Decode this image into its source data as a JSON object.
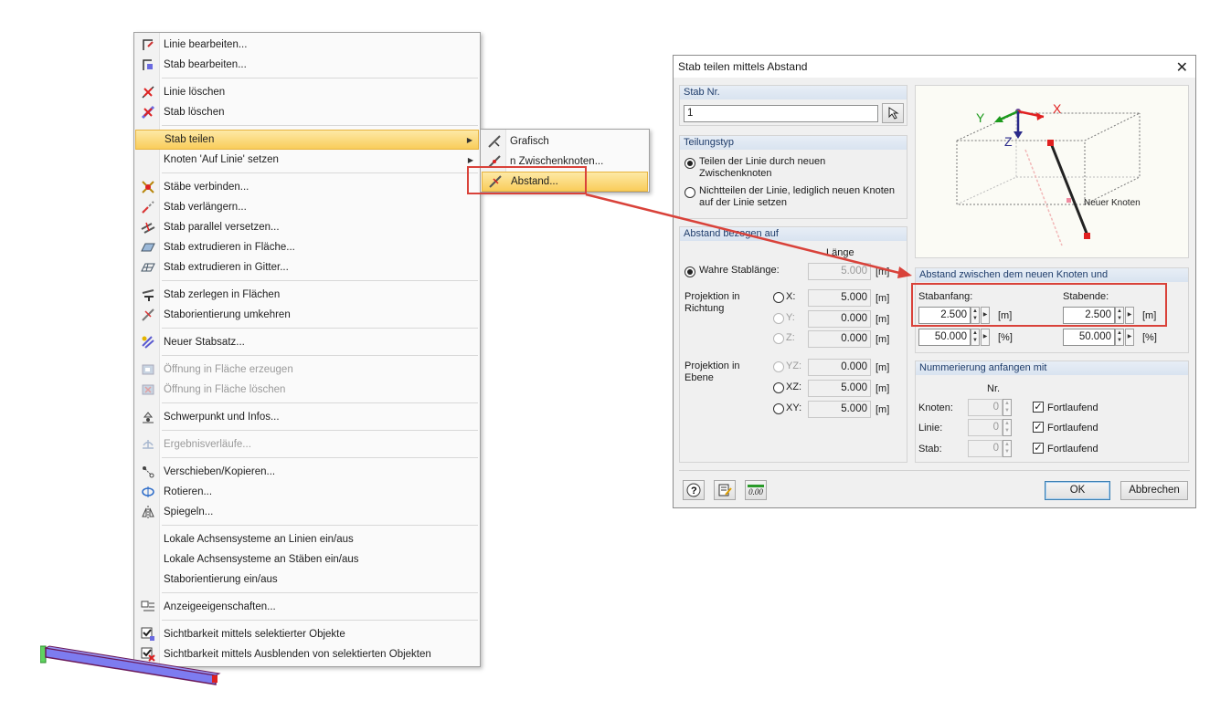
{
  "context_menu": {
    "items": [
      {
        "label": "Linie bearbeiten...",
        "icon": "edit-line-icon",
        "enabled": true
      },
      {
        "label": "Stab bearbeiten...",
        "icon": "edit-member-icon",
        "enabled": true
      },
      {
        "label": "Linie löschen",
        "icon": "delete-line-icon",
        "enabled": true
      },
      {
        "label": "Stab löschen",
        "icon": "delete-member-icon",
        "enabled": true
      },
      {
        "label": "Stab teilen",
        "icon": "",
        "enabled": true,
        "selected": true,
        "submenu": true
      },
      {
        "label": "Knoten 'Auf Linie' setzen",
        "icon": "",
        "enabled": true,
        "submenu": true
      },
      {
        "label": "Stäbe verbinden...",
        "icon": "connect-members-icon",
        "enabled": true
      },
      {
        "label": "Stab verlängern...",
        "icon": "extend-member-icon",
        "enabled": true
      },
      {
        "label": "Stab parallel versetzen...",
        "icon": "offset-member-icon",
        "enabled": true
      },
      {
        "label": "Stab extrudieren in Fläche...",
        "icon": "extrude-surface-icon",
        "enabled": true
      },
      {
        "label": "Stab extrudieren in Gitter...",
        "icon": "extrude-lattice-icon",
        "enabled": true
      },
      {
        "label": "Stab zerlegen in Flächen",
        "icon": "decompose-member-icon",
        "enabled": true
      },
      {
        "label": "Staborientierung umkehren",
        "icon": "reverse-orientation-icon",
        "enabled": true
      },
      {
        "label": "Neuer Stabsatz...",
        "icon": "new-set-icon",
        "enabled": true
      },
      {
        "label": "Öffnung in Fläche erzeugen",
        "icon": "create-opening-icon",
        "enabled": false
      },
      {
        "label": "Öffnung in Fläche löschen",
        "icon": "delete-opening-icon",
        "enabled": false
      },
      {
        "label": "Schwerpunkt und Infos...",
        "icon": "centroid-icon",
        "enabled": true
      },
      {
        "label": "Ergebnisverläufe...",
        "icon": "result-diagram-icon",
        "enabled": false
      },
      {
        "label": "Verschieben/Kopieren...",
        "icon": "move-copy-icon",
        "enabled": true
      },
      {
        "label": "Rotieren...",
        "icon": "rotate-icon",
        "enabled": true
      },
      {
        "label": "Spiegeln...",
        "icon": "mirror-icon",
        "enabled": true
      },
      {
        "label": "Lokale Achsensysteme an Linien ein/aus",
        "icon": "",
        "enabled": true
      },
      {
        "label": "Lokale Achsensysteme an Stäben ein/aus",
        "icon": "",
        "enabled": true
      },
      {
        "label": "Staborientierung ein/aus",
        "icon": "",
        "enabled": true
      },
      {
        "label": "Anzeigeeigenschaften...",
        "icon": "display-properties-icon",
        "enabled": true
      },
      {
        "label": "Sichtbarkeit mittels selektierter Objekte",
        "icon": "visibility-selected-icon",
        "enabled": true
      },
      {
        "label": "Sichtbarkeit mittels Ausblenden von selektierten Objekten",
        "icon": "visibility-hide-icon",
        "enabled": true
      }
    ]
  },
  "submenu": {
    "items": [
      {
        "label": "Grafisch",
        "icon": "graphic-divide-icon"
      },
      {
        "label": "n Zwischenknoten...",
        "icon": "n-nodes-icon"
      },
      {
        "label": "Abstand...",
        "icon": "distance-divide-icon",
        "selected": true
      }
    ]
  },
  "dialog": {
    "title": "Stab teilen mittels Abstand",
    "stab_nr": {
      "header": "Stab Nr.",
      "value": "1"
    },
    "teilungstyp": {
      "header": "Teilungstyp",
      "option1": "Teilen der Linie durch neuen Zwischenknoten",
      "option2": "Nichtteilen der Linie, lediglich neuen Knoten auf der Linie setzen"
    },
    "abstand": {
      "header": "Abstand bezogen auf",
      "laenge_header": "Länge",
      "wahre": "Wahre Stablänge:",
      "wahre_value": "5.000",
      "proj_richtung": "Projektion in Richtung",
      "proj_ebene": "Projektion in Ebene",
      "x_label": "X:",
      "x_value": "5.000",
      "y_label": "Y:",
      "y_value": "0.000",
      "z_label": "Z:",
      "z_value": "0.000",
      "yz_label": "YZ:",
      "yz_value": "0.000",
      "xz_label": "XZ:",
      "xz_value": "5.000",
      "xy_label": "XY:",
      "xy_value": "5.000",
      "unit": "[m]"
    },
    "preview": {
      "axis_x": "X",
      "axis_y": "Y",
      "axis_z": "Z",
      "node_label": "Neuer Knoten"
    },
    "abstand_knoten": {
      "header": "Abstand zwischen dem neuen Knoten und",
      "stabanfang": "Stabanfang:",
      "stabende": "Stabende:",
      "anfang_m": "2.500",
      "ende_m": "2.500",
      "anfang_pct": "50.000",
      "ende_pct": "50.000",
      "unit_m": "[m]",
      "unit_pct": "[%]"
    },
    "nummerierung": {
      "header": "Nummerierung anfangen mit",
      "nr": "Nr.",
      "knoten": "Knoten:",
      "knoten_value": "0",
      "linie": "Linie:",
      "linie_value": "0",
      "stab": "Stab:",
      "stab_value": "0",
      "fortlaufend": "Fortlaufend"
    },
    "ok": "OK",
    "cancel": "Abbrechen",
    "calc_icon_text": "0.00"
  },
  "colors": {
    "highlight": "#d9423a",
    "menu_selected": "#f9cd5b",
    "beam": "#7d7cf0"
  }
}
